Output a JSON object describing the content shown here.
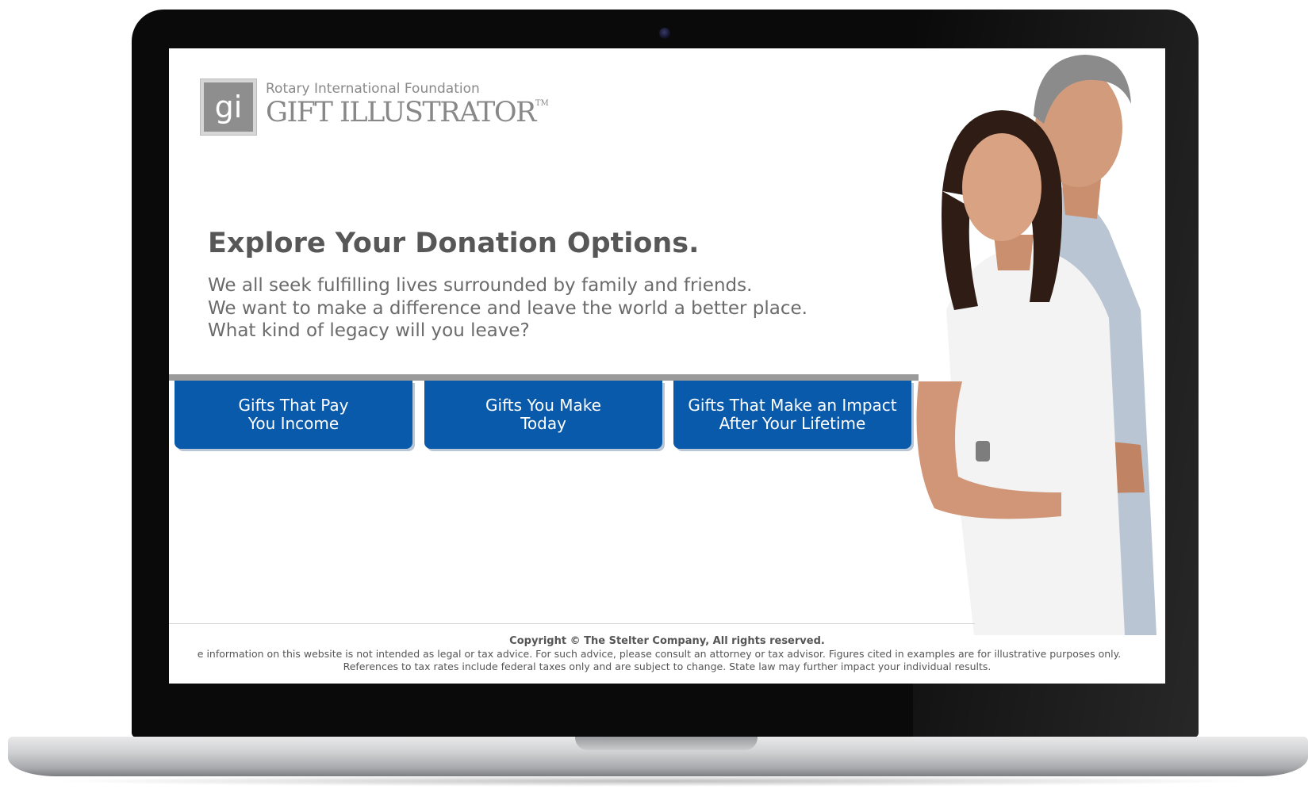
{
  "logo": {
    "mark": "gi",
    "organization": "Rotary International Foundation",
    "product": "GIFT ILLUSTRATOR",
    "trademark": "TM"
  },
  "hero": {
    "headline": "Explore Your Donation Options.",
    "lines": [
      "We all seek fulfilling lives surrounded by family and friends.",
      "We want to make a difference and leave the world a better place.",
      "What kind of legacy will you leave?"
    ]
  },
  "buttons": [
    {
      "line1": "Gifts That Pay",
      "line2": "You Income"
    },
    {
      "line1": "Gifts You Make",
      "line2": "Today"
    },
    {
      "line1": "Gifts That Make an Impact",
      "line2": "After Your Lifetime"
    }
  ],
  "footer": {
    "copyright": "Copyright © The Stelter Company, All rights reserved.",
    "line2": "e information on this website is not intended as legal or tax advice. For such advice, please consult an attorney or tax advisor. Figures cited in examples are for illustrative purposes only.",
    "line3": "References to tax rates include federal taxes only and are subject to change. State law may further impact your individual results."
  },
  "colors": {
    "button_blue": "#0a5aac",
    "divider_gray": "#9a9a9a",
    "headline_gray": "#575757"
  }
}
